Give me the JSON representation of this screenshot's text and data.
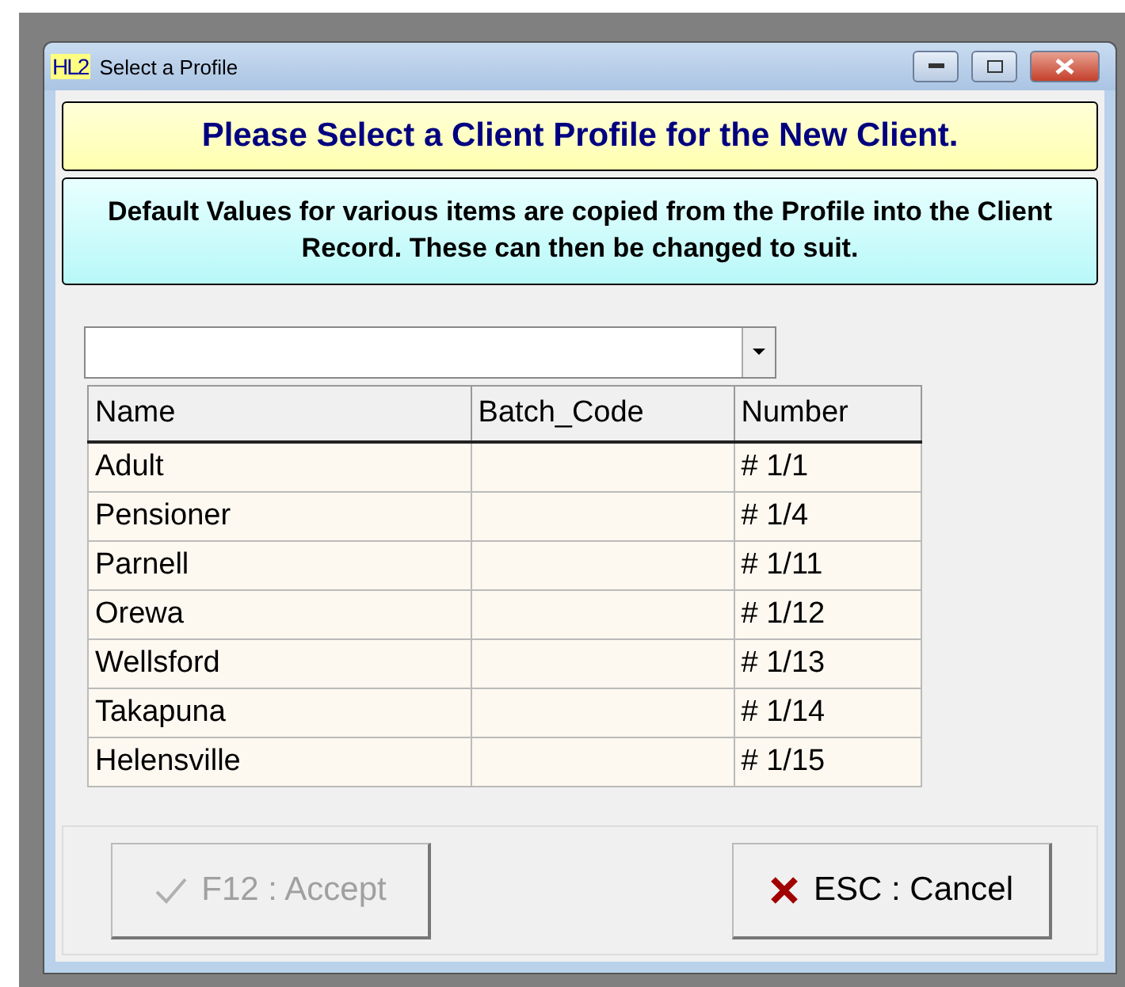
{
  "window": {
    "app_badge": "HL2",
    "title": "Select a Profile"
  },
  "heading": "Please Select a Client Profile for the New Client.",
  "info": "Default Values for various items are copied from the Profile into the Client Record.  These can then be changed to suit.",
  "table": {
    "columns": [
      "Name",
      "Batch_Code",
      "Number"
    ],
    "rows": [
      [
        "Adult",
        "",
        "# 1/1"
      ],
      [
        "Pensioner",
        "",
        "# 1/4"
      ],
      [
        "Parnell",
        "",
        "# 1/11"
      ],
      [
        "Orewa",
        "",
        "# 1/12"
      ],
      [
        "Wellsford",
        "",
        "# 1/13"
      ],
      [
        "Takapuna",
        "",
        "# 1/14"
      ],
      [
        "Helensville",
        "",
        "# 1/15"
      ]
    ]
  },
  "buttons": [
    {
      "kind": "accept",
      "label": "F12 : Accept",
      "disabled": true
    },
    {
      "kind": "cancel",
      "label": "ESC : Cancel",
      "disabled": false
    }
  ]
}
